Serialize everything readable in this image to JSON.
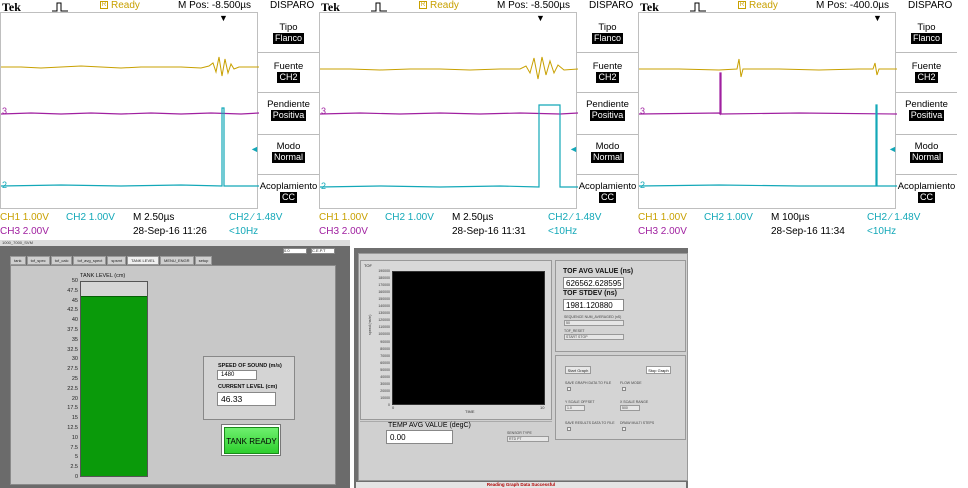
{
  "scopes": [
    {
      "brand": "Tek",
      "status": "Ready",
      "mpos": "M Pos: -8.500µs",
      "menu_title": "DISPARO",
      "menu": [
        {
          "label": "Tipo",
          "value": "Flanco"
        },
        {
          "label": "Fuente",
          "value": "CH2"
        },
        {
          "label": "Pendiente",
          "value": "Positiva"
        },
        {
          "label": "Modo",
          "value": "Normal"
        },
        {
          "label": "Acoplamiento",
          "value": "CC"
        }
      ],
      "ch1": "CH1  1.00V",
      "ch2": "CH2  1.00V",
      "ch3": "CH3  2.00V",
      "timebase": "M 2.50µs",
      "trigger": "CH2 ∕ 1.48V",
      "date": "28-Sep-16 11:26",
      "freq": "<10Hz",
      "markers": {
        "ch1": "1",
        "ch3": "3",
        "ch2": "2"
      }
    },
    {
      "brand": "Tek",
      "status": "Ready",
      "mpos": "M Pos: -8.500µs",
      "menu_title": "DISPARO",
      "menu": [
        {
          "label": "Tipo",
          "value": "Flanco"
        },
        {
          "label": "Fuente",
          "value": "CH2"
        },
        {
          "label": "Pendiente",
          "value": "Positiva"
        },
        {
          "label": "Modo",
          "value": "Normal"
        },
        {
          "label": "Acoplamiento",
          "value": "CC"
        }
      ],
      "ch1": "CH1  1.00V",
      "ch2": "CH2  1.00V",
      "ch3": "CH3  2.00V",
      "timebase": "M 2.50µs",
      "trigger": "CH2 ∕ 1.48V",
      "date": "28-Sep-16 11:31",
      "freq": "<10Hz",
      "markers": {
        "ch1": "1",
        "ch3": "3",
        "ch2": "2"
      }
    },
    {
      "brand": "Tek",
      "status": "Ready",
      "mpos": "M Pos: -400.0µs",
      "menu_title": "DISPARO",
      "menu": [
        {
          "label": "Tipo",
          "value": "Flanco"
        },
        {
          "label": "Fuente",
          "value": "CH2"
        },
        {
          "label": "Pendiente",
          "value": "Positiva"
        },
        {
          "label": "Modo",
          "value": "Normal"
        },
        {
          "label": "Acoplamiento",
          "value": "CC"
        }
      ],
      "ch1": "CH1  1.00V",
      "ch2": "CH2  1.00V",
      "ch3": "CH3  2.00V",
      "timebase": "M 100µs",
      "trigger": "CH2 ∕ 1.48V",
      "date": "28-Sep-16 11:34",
      "freq": "<10Hz",
      "markers": {
        "ch1": "1",
        "ch3": "3",
        "ch2": "2"
      }
    }
  ],
  "tank_app": {
    "window_title": "1000_7000_SVM",
    "tabs": [
      "tank",
      "tof_spec",
      "tof_calc",
      "tof_avg_spect",
      "spsmt",
      "TANK LEVEL",
      "MENU_ENGR",
      "setup"
    ],
    "active_tab": "TANK LEVEL",
    "top_field_1": "0.0",
    "top_field_2": "C.E.P.T",
    "tank_title": "TANK LEVEL (cm)",
    "scale": [
      "50",
      "47.5",
      "45",
      "42.5",
      "40",
      "37.5",
      "35",
      "32.5",
      "30",
      "27.5",
      "25",
      "22.5",
      "20",
      "17.5",
      "15",
      "12.5",
      "10",
      "7.5",
      "5",
      "2.5",
      "0"
    ],
    "level": 46.33,
    "scale_max": 50,
    "sos_label": "SPEED OF SOUND (m/s)",
    "sos_value": "1480",
    "current_label": "CURRENT LEVEL (cm)",
    "current_value": "46.33",
    "ready_label": "TANK READY"
  },
  "tof_app": {
    "graph_tag": "TOF",
    "y_ticks": [
      "190000",
      "180000",
      "170000",
      "160000",
      "150000",
      "140000",
      "130000",
      "120000",
      "110000",
      "100000",
      "90000",
      "80000",
      "70000",
      "60000",
      "50000",
      "40000",
      "30000",
      "20000",
      "10000",
      "0"
    ],
    "y_axis_label": "speed (ns/m)",
    "x_min": "0",
    "x_max": "10",
    "x_label": "TIME",
    "tof_avg_label": "TOF AVG VALUE (ns)",
    "tof_avg_value": "626562.628595",
    "tof_stdev_label": "TOF STDEV (ns)",
    "tof_stdev_value": "1981.120880",
    "minor_label_1": "SEQUENCE NUM_AVERAGED (nS)",
    "minor_value_1": "50",
    "minor_label_2": "TOF_RESET",
    "minor_value_2": "START STOP",
    "start_graph": "Start Graph",
    "stop_graph": "Stop Graph",
    "save_graph_label": "SAVE GRAPH DATA TO FILE",
    "flow_mode_label": "FLOW MODE",
    "yscale_label": "Y SCALE OFFSET",
    "yscale_value": "1.0",
    "xscale_label": "X SCALE RANGE",
    "xscale_value": "500",
    "save_results_label": "SAVE RESULTS DATA TO FILE",
    "multi_step_label": "DRAW MULTI STEPS",
    "temp_label": "TEMP AVG VALUE (degC)",
    "temp_value": "0.00",
    "sensor_label": "SENSOR TYPE",
    "sensor_value": "RTD PT",
    "status": "Reading Graph Data Successful"
  }
}
